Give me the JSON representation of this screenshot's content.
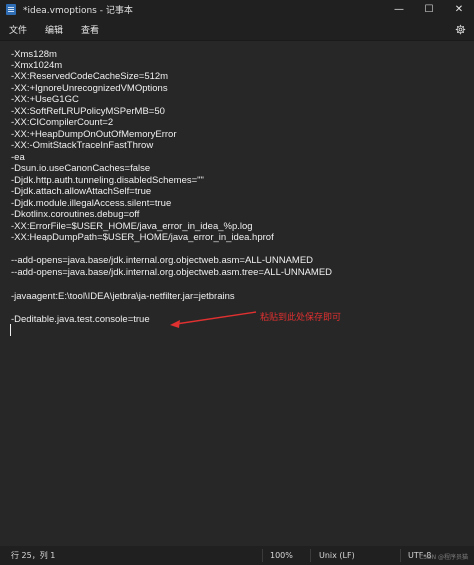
{
  "window": {
    "title": "*idea.vmoptions - 记事本",
    "minimize_glyph": "—",
    "maximize_glyph": "☐",
    "close_glyph": "✕"
  },
  "menu": {
    "items": [
      "文件",
      "编辑",
      "查看"
    ]
  },
  "editor": {
    "lines": [
      "-Xms128m",
      "-Xmx1024m",
      "-XX:ReservedCodeCacheSize=512m",
      "-XX:+IgnoreUnrecognizedVMOptions",
      "-XX:+UseG1GC",
      "-XX:SoftRefLRUPolicyMSPerMB=50",
      "-XX:CICompilerCount=2",
      "-XX:+HeapDumpOnOutOfMemoryError",
      "-XX:-OmitStackTraceInFastThrow",
      "-ea",
      "-Dsun.io.useCanonCaches=false",
      "-Djdk.http.auth.tunneling.disabledSchemes=\"\"",
      "-Djdk.attach.allowAttachSelf=true",
      "-Djdk.module.illegalAccess.silent=true",
      "-Dkotlinx.coroutines.debug=off",
      "-XX:ErrorFile=$USER_HOME/java_error_in_idea_%p.log",
      "-XX:HeapDumpPath=$USER_HOME/java_error_in_idea.hprof",
      "",
      "--add-opens=java.base/jdk.internal.org.objectweb.asm=ALL-UNNAMED",
      "--add-opens=java.base/jdk.internal.org.objectweb.asm.tree=ALL-UNNAMED",
      "",
      "-javaagent:E:\\tool\\IDEA\\jetbra\\ja-netfilter.jar=jetbrains",
      "",
      "-Deditable.java.test.console=true"
    ]
  },
  "annotation": {
    "text": "粘贴到此处保存即可",
    "color": "#e03030"
  },
  "status": {
    "position": "行 25，列 1",
    "zoom": "100%",
    "line_ending": "Unix (LF)",
    "encoding": "UTF-8"
  },
  "watermark": "CSDN @程序员猫",
  "colors": {
    "background": "#272727",
    "chrome": "#202020",
    "text": "#f0f0f0"
  }
}
